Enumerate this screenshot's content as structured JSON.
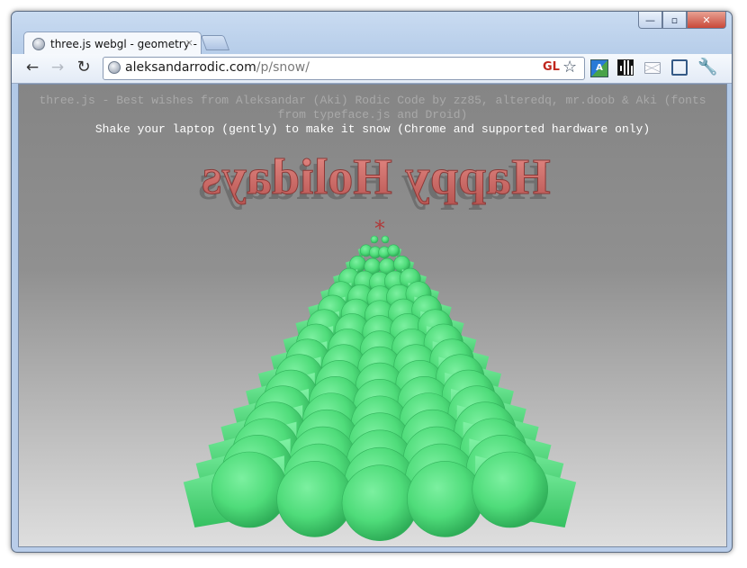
{
  "window": {
    "controls": {
      "minimize": "—",
      "maximize": "▫",
      "close": "✕"
    }
  },
  "tab": {
    "title": "three.js webgl - geometry -",
    "close": "×"
  },
  "toolbar": {
    "back": "←",
    "forward": "→",
    "reload": "↻",
    "url_host": "aleksandarrodic.com",
    "url_path": "/p/snow/",
    "gl_badge": "GL",
    "star": "☆",
    "translate_icon_text": "A",
    "wrench": "🔧"
  },
  "page": {
    "credits": "three.js - Best wishes from Aleksandar (Aki) Rodic Code by zz85, alteredq, mr.doob & Aki (fonts from typeface.js and Droid)",
    "instruction": "Shake your laptop (gently) to make it snow (Chrome and supported hardware only)",
    "headline_3d": "Happy Holidays",
    "tree_star": "*"
  },
  "colors": {
    "headline_fill": "#c86a68",
    "headline_shadow": "#7a7a7a",
    "tree_green": "#4fdc7a",
    "tree_dark": "#2e9e52",
    "star_red": "#b03a3a",
    "background_top": "#858585",
    "background_bottom": "#dedede"
  }
}
